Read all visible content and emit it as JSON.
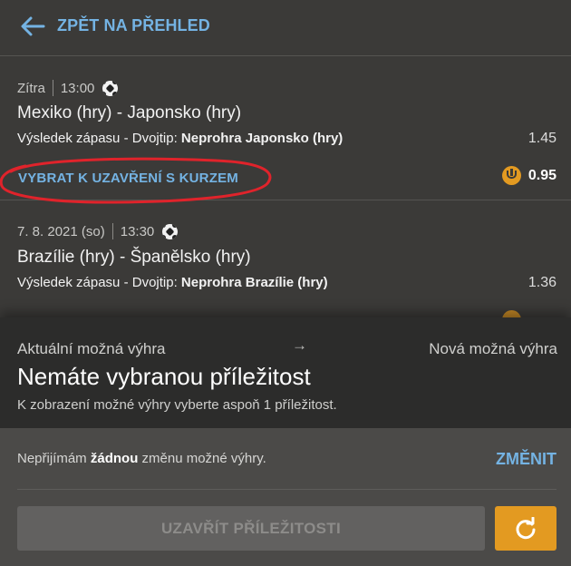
{
  "header": {
    "back_label": "ZPĚT NA PŘEHLED"
  },
  "bets": [
    {
      "date": "Zítra",
      "time": "13:00",
      "sport_icon": "soccer-ball-icon",
      "teams": "Mexiko (hry) - Japonsko (hry)",
      "market_prefix": "Výsledek zápasu - Dvojtip:",
      "selection": "Neprohra Japonsko (hry)",
      "odds": "1.45",
      "cashout_label": "VYBRAT K UZAVŘENÍ S KURZEM",
      "cashout_value": "0.95"
    },
    {
      "date": "7. 8. 2021 (so)",
      "time": "13:30",
      "sport_icon": "soccer-ball-icon",
      "teams": "Brazílie (hry) - Španělsko (hry)",
      "market_prefix": "Výsledek zápasu - Dvojtip:",
      "selection": "Neprohra Brazílie (hry)",
      "odds": "1.36"
    }
  ],
  "summary": {
    "current_label": "Aktuální možná výhra",
    "arrow": "→",
    "new_label": "Nová možná výhra",
    "headline": "Nemáte vybranou příležitost",
    "hint": "K zobrazení možné výhry vyberte aspoň 1 příležitost."
  },
  "footer": {
    "accept_prefix": "Nepřijímám",
    "accept_bold": "žádnou",
    "accept_suffix": "změnu možné výhry.",
    "change_label": "ZMĚNIT",
    "close_button": "UZAVŘÍT PŘÍLEŽITOSTI"
  },
  "colors": {
    "background": "#3b3a38",
    "accent_blue": "#74b3e3",
    "accent_orange": "#e39a21",
    "annotation_red": "#e0232b"
  }
}
